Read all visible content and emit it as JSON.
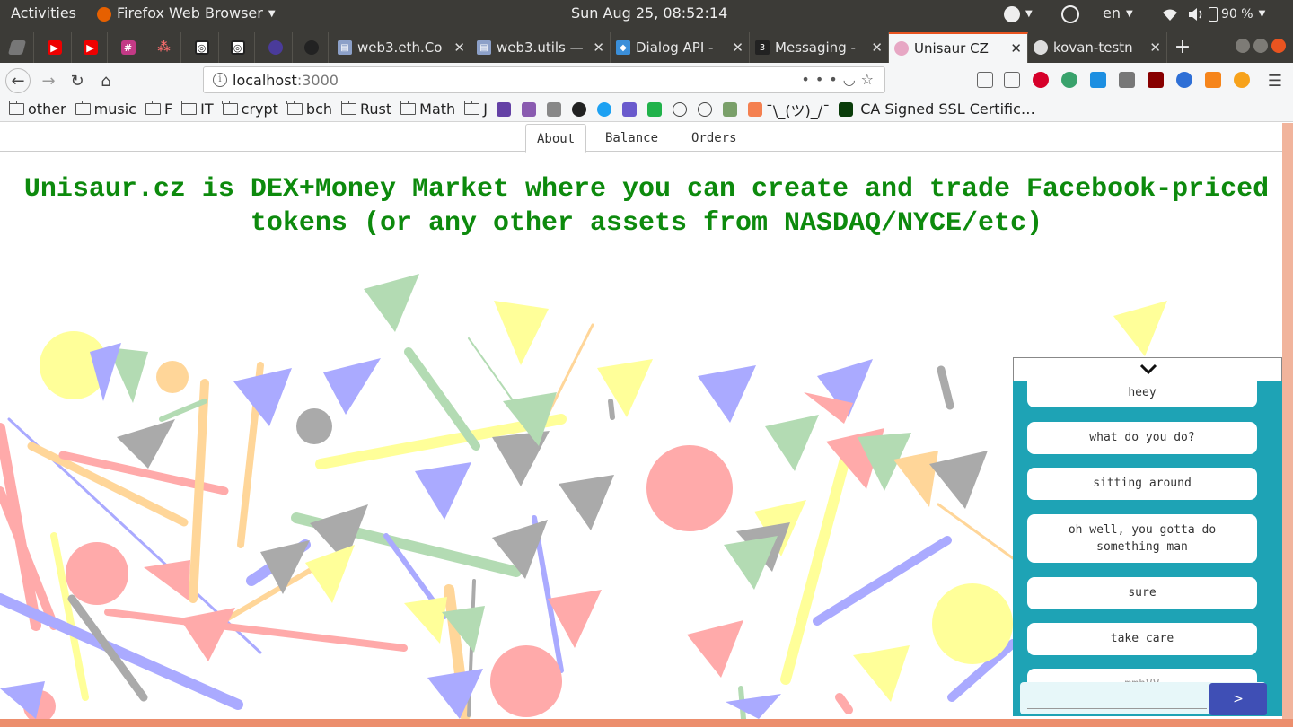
{
  "topbar": {
    "activities": "Activities",
    "app_name": "Firefox Web Browser",
    "clock": "Sun Aug 25, 08:52:14",
    "language": "en",
    "battery": "90 %"
  },
  "browser": {
    "tabs": [
      {
        "title": "web3.eth.Co",
        "icon": "doc-icon"
      },
      {
        "title": "web3.utils —",
        "icon": "doc-icon"
      },
      {
        "title": "Dialog API -",
        "icon": "dialog-icon"
      },
      {
        "title": "Messaging -",
        "icon": "3box-icon"
      },
      {
        "title": "Unisaur CZ",
        "icon": "unisaur-icon",
        "active": true
      },
      {
        "title": "kovan-testn",
        "icon": "github-icon"
      }
    ],
    "pinned_tabs": [
      "pinned-app-icon",
      "youtube-icon",
      "youtube-icon",
      "slack-icon",
      "asana-icon",
      "target-icon",
      "target-icon",
      "bulb-icon",
      "github-icon"
    ],
    "url_host": "localhost",
    "url_port": ":3000",
    "bookmarks": [
      "other",
      "music",
      "F",
      "IT",
      "crypt",
      "bch",
      "Rust",
      "Math",
      "J"
    ],
    "bookmark_shrug": "¯\\_(ツ)_/¯",
    "bookmark_ca": "CA Signed SSL Certific…"
  },
  "page": {
    "tabs": [
      "About",
      "Balance",
      "Orders"
    ],
    "active_tab": "About",
    "headline": "Unisaur.cz is DEX+Money Market where you can create and trade Facebook-priced tokens (or any other assets from NASDAQ/NYCE/etc)"
  },
  "chat": {
    "messages": [
      "heey",
      "what do you do?",
      "sitting around",
      "oh well, you gotta do something man",
      "sure",
      "take care",
      "mmhVV"
    ],
    "input_placeholder": "",
    "send_label": ">"
  },
  "colors": {
    "headline": "#0d8a0d",
    "chat_bg": "#1ea3b5",
    "send_button": "#3f4fb5",
    "accent": "#e95420"
  }
}
